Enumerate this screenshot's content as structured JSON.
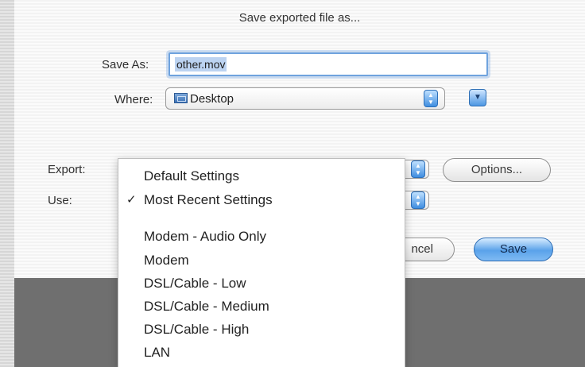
{
  "dialog": {
    "title": "Save exported file as...",
    "save_as_label": "Save As:",
    "save_as_value": "other.mov",
    "where_label": "Where:",
    "where_value": "Desktop",
    "export_label": "Export:",
    "use_label": "Use:",
    "options_label": "Options...",
    "cancel_label_partial": "ncel",
    "save_label": "Save"
  },
  "menu": {
    "items": [
      {
        "label": "Default Settings",
        "checked": false
      },
      {
        "label": "Most Recent Settings",
        "checked": true
      },
      {
        "label": "Modem - Audio Only",
        "checked": false
      },
      {
        "label": "Modem",
        "checked": false
      },
      {
        "label": "DSL/Cable - Low",
        "checked": false
      },
      {
        "label": "DSL/Cable - Medium",
        "checked": false
      },
      {
        "label": "DSL/Cable - High",
        "checked": false
      },
      {
        "label": "LAN",
        "checked": false
      }
    ],
    "check_glyph": "✓"
  },
  "icons": {
    "folder": "folder-icon",
    "stepper": "popup-stepper-icon",
    "expand": "disclosure-icon"
  },
  "colors": {
    "accent": "#5aa2ea",
    "focus_ring": "#6fa3de",
    "selection": "#bcd3f1"
  }
}
